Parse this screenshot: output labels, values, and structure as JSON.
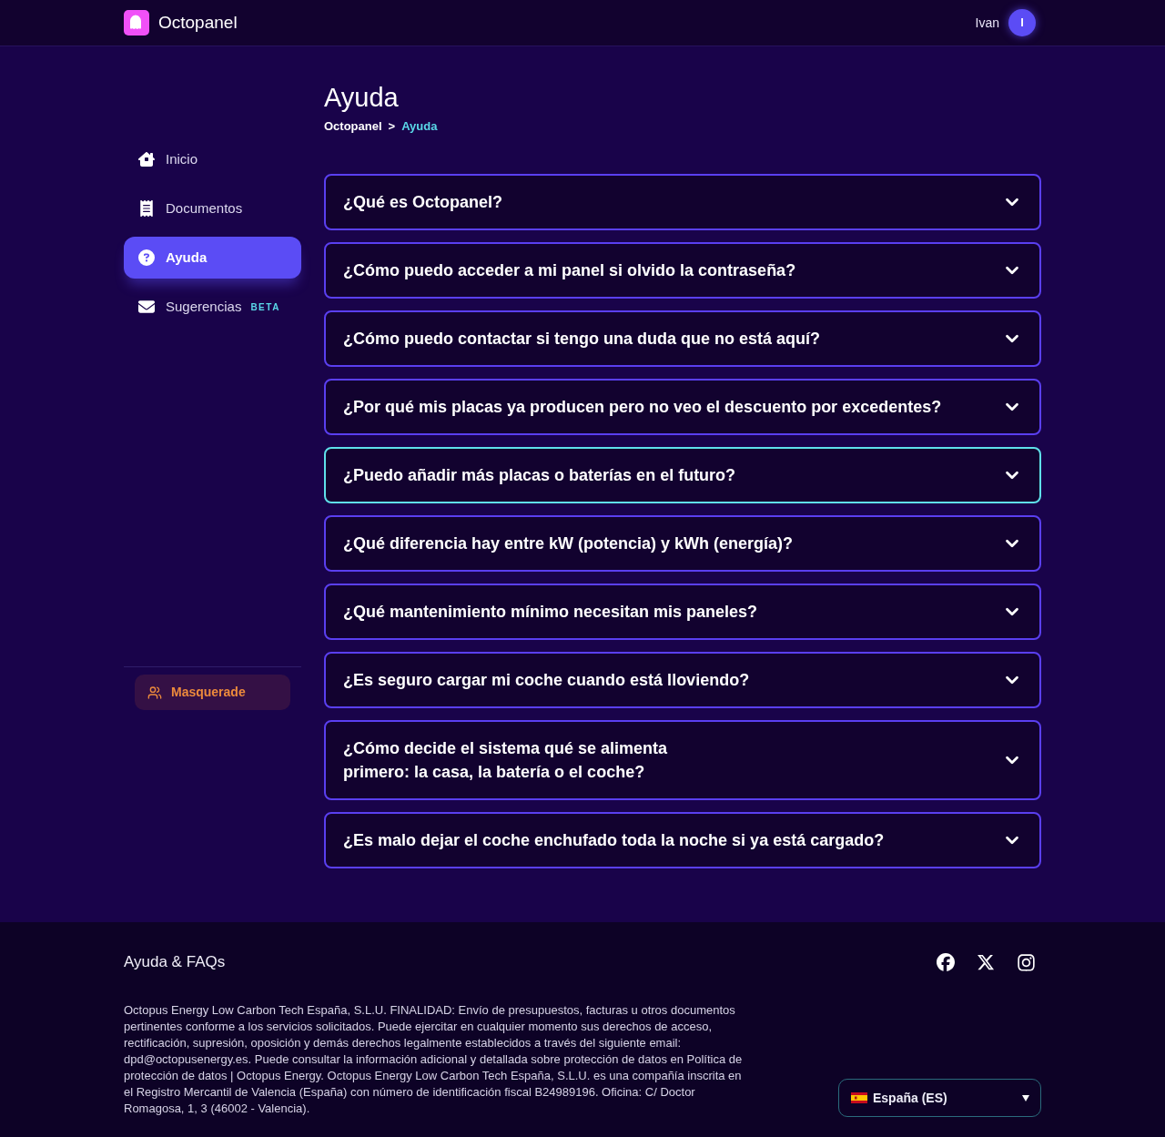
{
  "header": {
    "brand": "Octopanel",
    "user": {
      "name": "Ivan",
      "initial": "I"
    }
  },
  "page": {
    "title": "Ayuda",
    "breadcrumb": [
      {
        "label": "Octopanel",
        "current": false
      },
      {
        "label": "Ayuda",
        "current": true
      }
    ],
    "separator": ">"
  },
  "sidebar": {
    "items": [
      {
        "label": "Inicio",
        "selected": false
      },
      {
        "label": "Documentos",
        "selected": false
      },
      {
        "label": "Ayuda",
        "selected": true
      },
      {
        "label": "Sugerencias",
        "selected": false,
        "badge": "BETA"
      }
    ],
    "masquerade": "Masquerade"
  },
  "faq": [
    {
      "question": "¿Qué es Octopanel?",
      "expanded": false,
      "focused": false
    },
    {
      "question": "¿Cómo puedo acceder a mi panel si olvido la contraseña?",
      "expanded": false,
      "focused": false
    },
    {
      "question": "¿Cómo puedo contactar si tengo una duda que no está aquí?",
      "expanded": false,
      "focused": false
    },
    {
      "question": "¿Por qué mis placas ya producen pero no veo el descuento por excedentes?",
      "expanded": false,
      "focused": false
    },
    {
      "question": "¿Puedo añadir más placas o baterías en el futuro?",
      "expanded": false,
      "focused": true
    },
    {
      "question": "¿Qué diferencia hay entre kW (potencia) y kWh (energía)?",
      "expanded": false,
      "focused": false
    },
    {
      "question": "¿Qué mantenimiento mínimo necesitan mis paneles?",
      "expanded": false,
      "focused": false
    },
    {
      "question": "¿Es seguro cargar mi coche cuando está lloviendo?",
      "expanded": false,
      "focused": false
    },
    {
      "question": "¿Cómo decide el sistema qué se alimenta\nprimero: la casa, la batería o el coche?",
      "expanded": false,
      "focused": false
    },
    {
      "question": "¿Es malo dejar el coche enchufado toda la noche si ya está cargado?",
      "expanded": false,
      "focused": false
    }
  ],
  "footer": {
    "title": "Ayuda & FAQs",
    "legal": "Octopus Energy Low Carbon Tech España, S.L.U. FINALIDAD: Envío de presupuestos, facturas u otros documentos pertinentes conforme a los servicios solicitados. Puede ejercitar en cualquier momento sus derechos de acceso, rectificación, supresión, oposición y demás derechos legalmente establecidos a través del siguiente email: dpd@octopusenergy.es. Puede consultar la información adicional y detallada sobre protección de datos en Política de protección de datos | Octopus Energy. Octopus Energy Low Carbon Tech España, S.L.U. es una compañía inscrita en el Registro Mercantil de Valencia (España) con número de identificación fiscal B24989196. Oficina: C/ Doctor Romagosa, 1, 3 (46002 - Valencia).",
    "language": {
      "value": "España (ES)"
    }
  }
}
